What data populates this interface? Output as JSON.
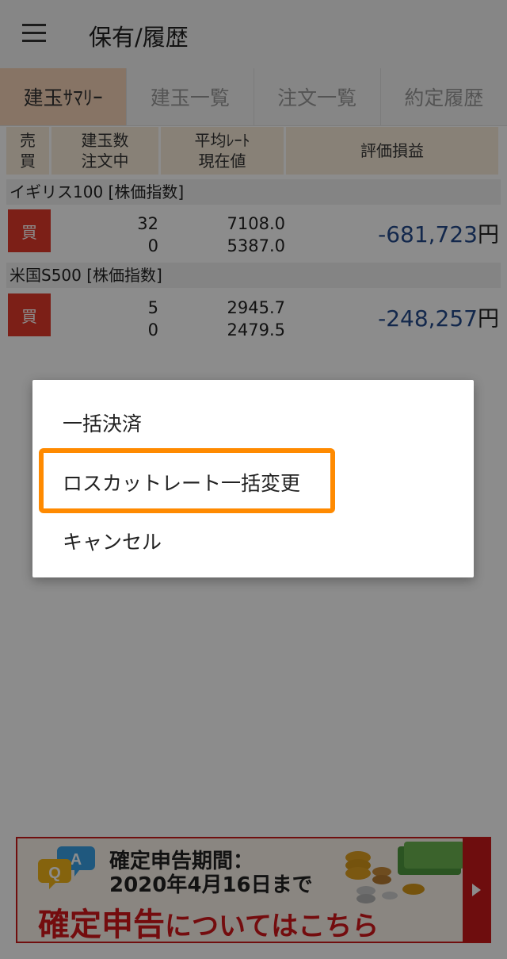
{
  "header": {
    "title": "保有/履歴"
  },
  "tabs": [
    {
      "label": "建玉ｻﾏﾘｰ",
      "active": true
    },
    {
      "label": "建玉一覧"
    },
    {
      "label": "注文一覧"
    },
    {
      "label": "約定履歴"
    }
  ],
  "table": {
    "headers": {
      "col1_line1": "売",
      "col1_line2": "買",
      "col2_line1": "建玉数",
      "col2_line2": "注文中",
      "col3_line1": "平均ﾚｰﾄ",
      "col3_line2": "現在値",
      "col4": "評価損益"
    },
    "positions": [
      {
        "name": "イギリス100 [株価指数]",
        "side": "買",
        "qty": "32",
        "ordering": "0",
        "avg_rate": "7108.0",
        "current": "5387.0",
        "pl": "-681,723",
        "unit": "円"
      },
      {
        "name": "米国S500 [株価指数]",
        "side": "買",
        "qty": "5",
        "ordering": "0",
        "avg_rate": "2945.7",
        "current": "2479.5",
        "pl": "-248,257",
        "unit": "円"
      }
    ]
  },
  "dialog": {
    "option1": "一括決済",
    "option2": "ロスカットレート一括変更",
    "option3": "キャンセル"
  },
  "banner": {
    "line1": "確定申告期間：",
    "line2": "2020年4月16日まで",
    "line3_emph": "確定申告",
    "line3_rest": "についてはこちら",
    "qa_q": "Q",
    "qa_a": "A"
  },
  "colors": {
    "accent": "#ff8a00",
    "buy": "#e23a2b",
    "loss": "#244a8a",
    "banner_red": "#d3161b"
  }
}
